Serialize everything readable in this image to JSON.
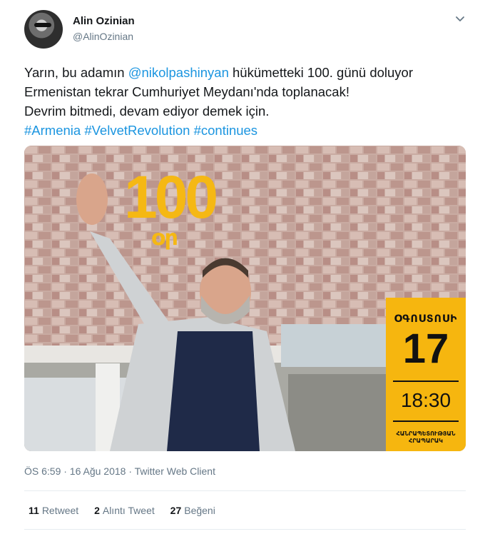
{
  "author": {
    "display_name": "Alin Ozinian",
    "handle": "@AlinOzinian",
    "avatar_icon": "user-avatar"
  },
  "menu_icon": "chevron-down-icon",
  "tweet": {
    "line1_prefix": "Yarın, bu adamın ",
    "mention": "@nikolpashinyan",
    "line1_suffix": " hükümetteki 100. günü doluyor",
    "line2": "Ermenistan tekrar Cumhuriyet Meydanı'nda toplanacak!",
    "line3": "Devrim bitmedi, devam ediyor demek için.",
    "hashtags": [
      "#Armenia",
      "#VelvetRevolution",
      "#continues"
    ]
  },
  "media": {
    "number": "100",
    "number_caption": "օր",
    "month": "ՕԳՈՍՏՈՍԻ",
    "day": "17",
    "time": "18:30",
    "place_line1": "ՀԱՆՐԱՊԵՏՈՒԹՅԱՆ",
    "place_line2": "ՀՐԱՊԱՐԱԿ",
    "accent_color": "#f6b60f"
  },
  "timestamp": "ÖS 6:59 · 16 Ağu 2018 · Twitter Web Client",
  "stats": {
    "retweets_count": "11",
    "retweets_label": "Retweet",
    "quotes_count": "2",
    "quotes_label": "Alıntı Tweet",
    "likes_count": "27",
    "likes_label": "Beğeni"
  }
}
